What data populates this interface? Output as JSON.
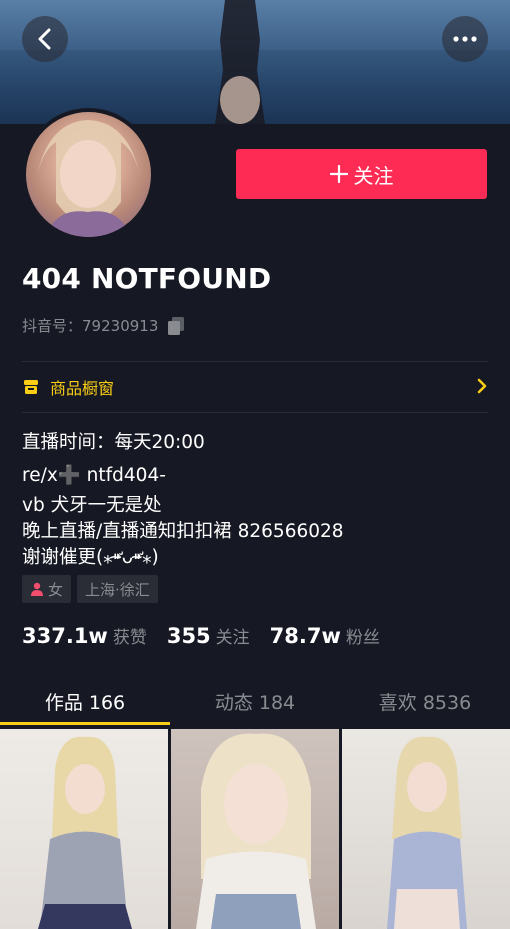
{
  "header": {
    "back_icon": "chevron-left-icon",
    "more_icon": "more-horizontal-icon"
  },
  "profile": {
    "follow_label": "关注",
    "nickname": "404 NOTFOUND",
    "douyin_id_label": "抖音号：",
    "douyin_id": "79230913"
  },
  "shop": {
    "label": "商品橱窗"
  },
  "bio": {
    "live_time": "直播时间：每天20:00",
    "line1": "re/x➕ ntfd404-",
    "line2": "vb 犬牙一无是处",
    "line3": "晚上直播/直播通知扣扣裙 826566028",
    "line4": "谢谢催更(⁎⁍̴̛ᴗ⁍̴̛⁎)"
  },
  "tags": {
    "gender": "女",
    "location": "上海·徐汇"
  },
  "stats": {
    "likes_num": "337.1w",
    "likes_label": "获赞",
    "following_num": "355",
    "following_label": "关注",
    "followers_num": "78.7w",
    "followers_label": "粉丝"
  },
  "tabs": [
    {
      "label": "作品 166"
    },
    {
      "label": "动态 184"
    },
    {
      "label": "喜欢 8536"
    }
  ],
  "colors": {
    "background": "#161823",
    "accent_red": "#fe2c55",
    "accent_yellow": "#face15",
    "muted_text": "#8a8b91"
  }
}
